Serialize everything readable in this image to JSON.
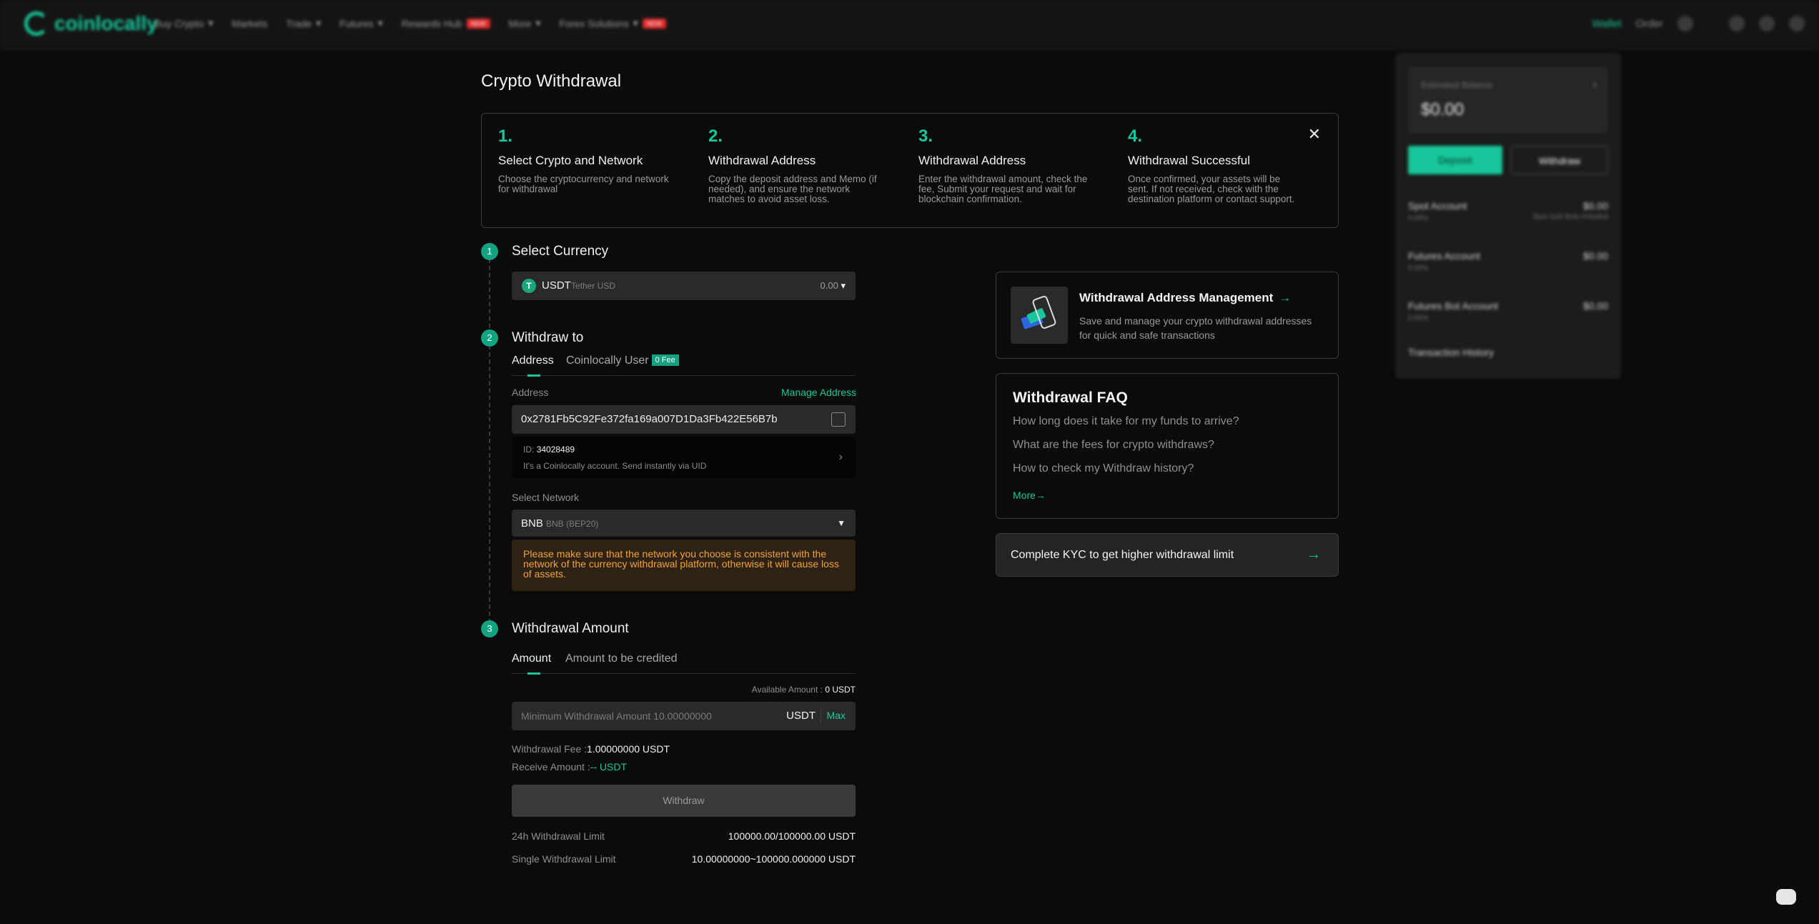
{
  "nav": {
    "logo": "coinlocally",
    "menu": [
      {
        "label": "Buy Crypto"
      },
      {
        "label": "Markets"
      },
      {
        "label": "Trade"
      },
      {
        "label": "Futures"
      },
      {
        "label": "Rewards Hub",
        "badge": "NEW"
      },
      {
        "label": "More"
      },
      {
        "label": "Forex Solutions",
        "badge": "NEW"
      }
    ],
    "wallet": "Wallet",
    "order": "Order"
  },
  "page_title": "Crypto Withdrawal",
  "steps": [
    {
      "num": "1.",
      "title": "Select Crypto and Network",
      "desc": "Choose the cryptocurrency and network for withdrawal"
    },
    {
      "num": "2.",
      "title": "Withdrawal Address",
      "desc": "Copy the deposit address and Memo (if needed), and ensure the network matches to avoid asset loss."
    },
    {
      "num": "3.",
      "title": "Withdrawal Address",
      "desc": "Enter the withdrawal amount, check the fee, Submit your request and wait for blockchain confirmation."
    },
    {
      "num": "4.",
      "title": "Withdrawal Successful",
      "desc": "Once confirmed, your assets will be sent. If not received, check with the destination platform or contact support."
    }
  ],
  "section1": {
    "num": "1",
    "title": "Select Currency",
    "currency_symbol": "USDT",
    "currency_name": "Tether USD",
    "balance": "0.00"
  },
  "section2": {
    "num": "2",
    "title": "Withdraw to",
    "tab_address": "Address",
    "tab_user": "Coinlocally User",
    "zero_fee": "0 Fee",
    "address_label": "Address",
    "manage_address": "Manage Address",
    "address_value": "0x2781Fb5C92Fe372fa169a007D1Da3Fb422E56B7b",
    "uid_label": "ID:",
    "uid_value": "34028489",
    "uid_msg": "It's a Coinlocally account. Send instantly via UID",
    "network_label": "Select Network",
    "network_symbol": "BNB",
    "network_name": "BNB (BEP20)",
    "warning": "Please make sure that the network you choose is consistent with the network of the currency withdrawal platform, otherwise it will cause loss of assets."
  },
  "section3": {
    "num": "3",
    "title": "Withdrawal Amount",
    "tab_amount": "Amount",
    "tab_credited": "Amount to be credited",
    "available_label": "Available Amount :",
    "available_value": "0 USDT",
    "amount_placeholder": "Minimum Withdrawal Amount 10.00000000",
    "unit": "USDT",
    "max": "Max",
    "fee_label": "Withdrawal Fee :",
    "fee_value": "1.00000000 USDT",
    "receive_label": "Receive Amount :",
    "receive_value": "-- USDT",
    "withdraw_button": "Withdraw",
    "limit_24h_label": "24h Withdrawal Limit",
    "limit_24h_value": "100000.00/100000.00 USDT",
    "limit_single_label": "Single Withdrawal Limit",
    "limit_single_value": "10.00000000~100000.000000 USDT"
  },
  "address_mgmt": {
    "title": "Withdrawal Address Management",
    "desc": "Save and manage your crypto withdrawal addresses for quick and safe transactions"
  },
  "faq": {
    "title": "Withdrawal FAQ",
    "questions": [
      "How long does it take for my funds to arrive?",
      "What are the fees for crypto withdraws?",
      "How to check my Withdraw history?"
    ],
    "more": "More"
  },
  "kyc": {
    "text": "Complete KYC to get higher withdrawal limit"
  },
  "account_panel": {
    "estimated_label": "Estimated Balance",
    "estimated_value": "$0.00",
    "deposit": "Deposit",
    "withdraw": "Withdraw",
    "rows": [
      {
        "label": "Spot Account",
        "value": "$0.00",
        "sub": "0.00%",
        "subvalue": "Spot Grid Bots Included"
      },
      {
        "label": "Futures Account",
        "value": "$0.00",
        "sub": "0.00%"
      },
      {
        "label": "Futures Bot Account",
        "value": "$0.00",
        "sub": "0.00%"
      },
      {
        "label": "Transaction History"
      }
    ]
  },
  "colors": {
    "accent": "#17c69a",
    "warning": "#f2a23a",
    "background": "#0b0b0b"
  }
}
